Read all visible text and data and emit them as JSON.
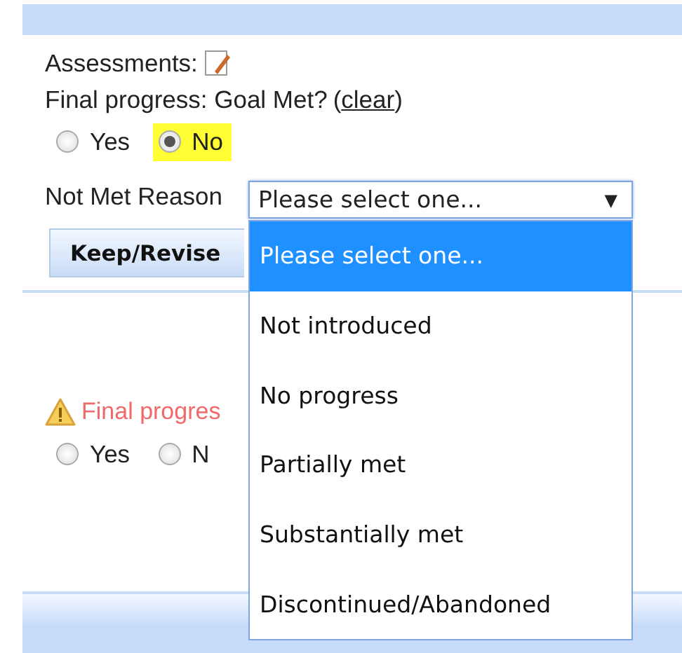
{
  "assessments_label": "Assessments:",
  "goal": {
    "question": "Final progress: Goal Met?",
    "paren_open": "(",
    "clear_link": "clear",
    "paren_close": ")"
  },
  "goal_options": [
    {
      "label": "Yes",
      "selected": false,
      "highlighted": false
    },
    {
      "label": "No",
      "selected": true,
      "highlighted": true
    }
  ],
  "reason": {
    "label": "Not Met Reason",
    "value": "Please select one...",
    "arrow": "▼",
    "expanded": true
  },
  "reason_options": [
    {
      "label": "Please select one...",
      "selected": true
    },
    {
      "label": "Not introduced",
      "selected": false
    },
    {
      "label": "No progress",
      "selected": false
    },
    {
      "label": "Partially met",
      "selected": false
    },
    {
      "label": "Substantially met",
      "selected": false
    },
    {
      "label": "Discontinued/Abandoned",
      "selected": false
    }
  ],
  "keep_button": "Keep/Revise",
  "warning": {
    "text": "Final progres"
  },
  "second_options": [
    {
      "label": "Yes",
      "selected": false,
      "highlighted": false
    },
    {
      "label": "N",
      "selected": false,
      "highlighted": false
    }
  ]
}
